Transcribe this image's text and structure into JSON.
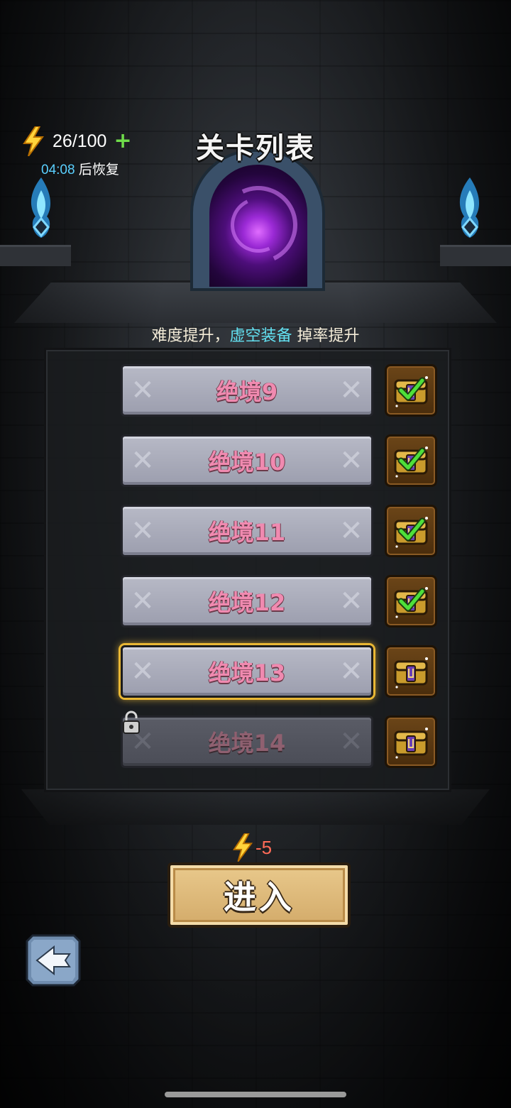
{
  "energy": {
    "current": "26/100",
    "recover_time": "04:08",
    "recover_suffix": " 后恢复"
  },
  "title": "关卡列表",
  "subtitle": {
    "prefix": "难度提升，",
    "highlight": "虚空装备",
    "suffix": " 掉率提升"
  },
  "levels": [
    {
      "label": "绝境9",
      "state": "cleared",
      "reward_claimed": true
    },
    {
      "label": "绝境10",
      "state": "cleared",
      "reward_claimed": true
    },
    {
      "label": "绝境11",
      "state": "cleared",
      "reward_claimed": true
    },
    {
      "label": "绝境12",
      "state": "cleared",
      "reward_claimed": true
    },
    {
      "label": "绝境13",
      "state": "selected",
      "reward_claimed": false
    },
    {
      "label": "绝境14",
      "state": "locked",
      "reward_claimed": false
    }
  ],
  "enter": {
    "cost": "-5",
    "label": "进入"
  },
  "icons": {
    "energy": "lightning-bolt-icon",
    "plus": "plus-icon",
    "chest": "treasure-chest-icon",
    "check": "checkmark-icon",
    "lock": "padlock-icon",
    "back": "back-arrow-icon",
    "torch": "blue-flame-icon"
  },
  "colors": {
    "accent_cyan": "#5ad0ff",
    "highlight": "#62e0f0",
    "level_text": "#f08ab0",
    "selected_border": "#e9b734",
    "cost": "#ff6b57",
    "plus": "#6fdc4a"
  }
}
